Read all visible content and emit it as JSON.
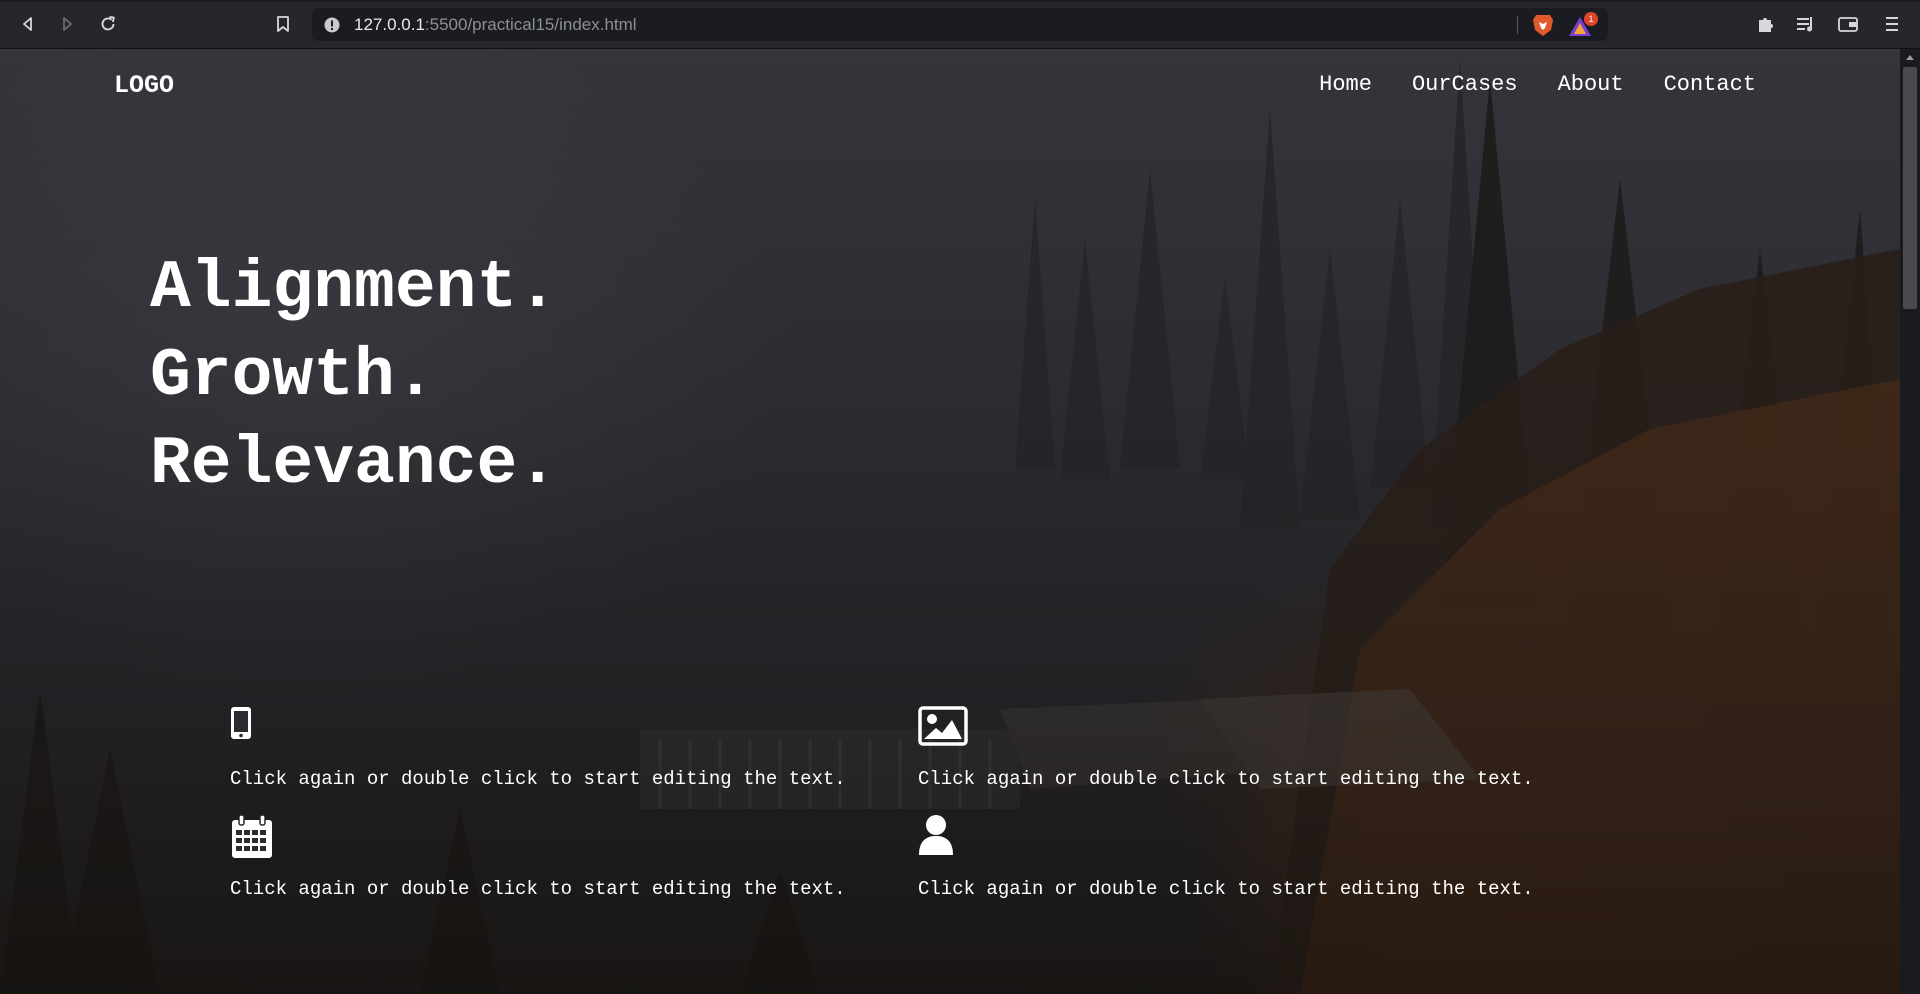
{
  "browser": {
    "url_host": "127.0.0.1",
    "url_rest": ":5500/practical15/index.html",
    "rewards_badge": "1"
  },
  "site": {
    "logo": "LOGO",
    "nav": [
      "Home",
      "OurCases",
      "About",
      "Contact"
    ],
    "hero_lines": [
      "Alignment.",
      "Growth.",
      "Relevance."
    ],
    "features": [
      {
        "icon": "mobile-phone-icon",
        "text": "Click again or double click to start editing the text."
      },
      {
        "icon": "image-icon",
        "text": "Click again or double click to start editing the text."
      },
      {
        "icon": "calendar-icon",
        "text": "Click again or double click to start editing the text."
      },
      {
        "icon": "user-icon",
        "text": "Click again or double click to start editing the text."
      }
    ]
  },
  "colors": {
    "chrome_bg": "#26272d",
    "urlbar_bg": "#1b1c21",
    "text_white": "#ffffff",
    "autumn_accent": "#783a12"
  }
}
